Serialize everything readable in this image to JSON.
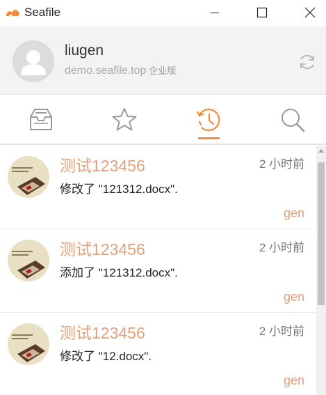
{
  "window": {
    "title": "Seafile",
    "icons": {
      "logo": "seafile-logo",
      "minimize": "minimize-icon",
      "maximize": "maximize-icon",
      "close": "close-icon"
    }
  },
  "account": {
    "username": "liugen",
    "server": "demo.seafile.top",
    "edition": "企业版",
    "icons": {
      "avatar": "default-avatar",
      "refresh": "refresh-icon"
    }
  },
  "tabs": [
    {
      "name": "libraries",
      "icon": "inbox-icon",
      "active": false
    },
    {
      "name": "starred",
      "icon": "star-icon",
      "active": false
    },
    {
      "name": "activity",
      "icon": "history-icon",
      "active": true
    },
    {
      "name": "search",
      "icon": "search-icon",
      "active": false
    }
  ],
  "colors": {
    "accent": "#f28c3a",
    "title_text": "#e0a07c",
    "header_bg": "#f3f3f3"
  },
  "activities": [
    {
      "title": "测试123456",
      "time": "2 小时前",
      "description": "修改了 \"121312.docx\".",
      "user": "gen"
    },
    {
      "title": "测试123456",
      "time": "2 小时前",
      "description": "添加了 \"121312.docx\".",
      "user": "gen"
    },
    {
      "title": "测试123456",
      "time": "2 小时前",
      "description": "修改了 \"12.docx\".",
      "user": "gen"
    }
  ]
}
